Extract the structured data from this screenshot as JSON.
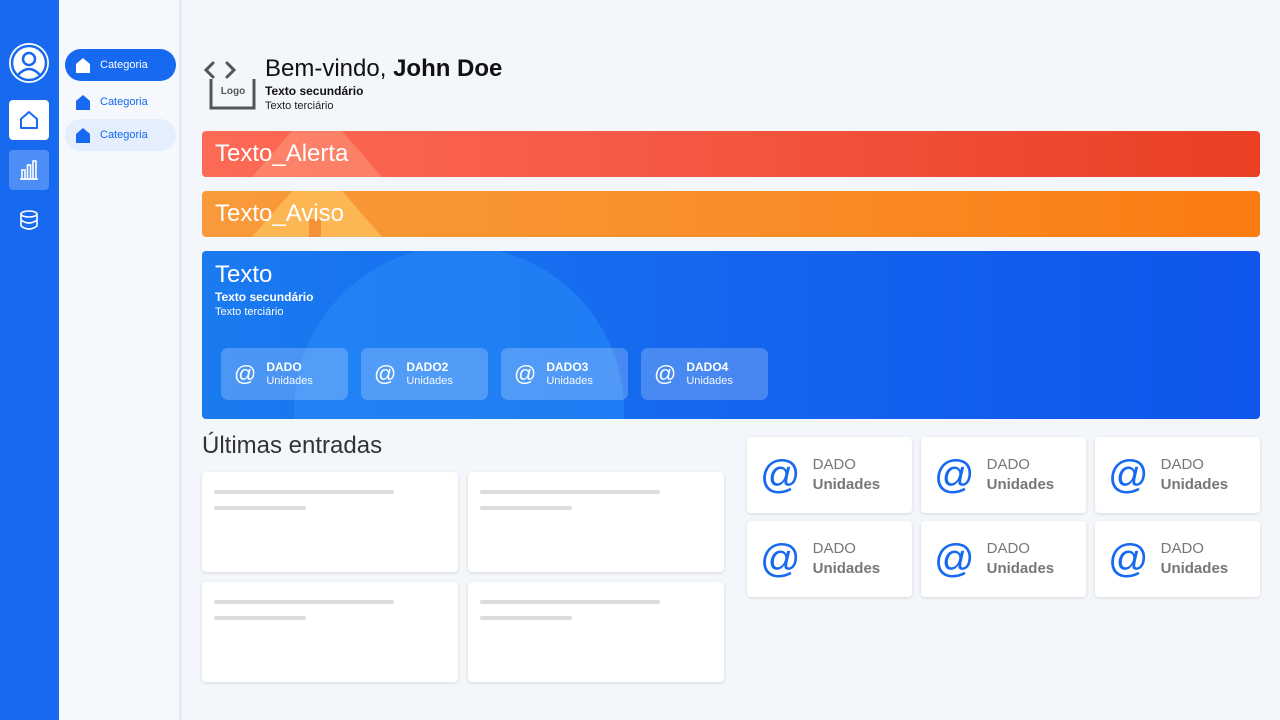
{
  "colors": {
    "primary": "#1769f0",
    "alert": "#ea3f23",
    "warning": "#fb7b10",
    "background": "#f3f6fa"
  },
  "rail": {
    "icons": [
      "user-avatar-icon",
      "home-icon",
      "bar-chart-icon",
      "database-icon"
    ]
  },
  "subnav": {
    "items": [
      {
        "label": "Categoria",
        "icon": "house-icon",
        "state": "active"
      },
      {
        "label": "Categoria",
        "icon": "house-icon",
        "state": "default"
      },
      {
        "label": "Categoria",
        "icon": "house-icon",
        "state": "hover"
      }
    ]
  },
  "header": {
    "logo_text": "Logo",
    "greeting_prefix": "Bem-vindo, ",
    "user_name": "John Doe",
    "secondary": "Texto secundário",
    "tertiary": "Texto terciário"
  },
  "banners": {
    "alert": "Texto_Alerta",
    "warning": "Texto_Aviso"
  },
  "hero": {
    "title": "Texto",
    "secondary": "Texto secundário",
    "tertiary": "Texto terciário",
    "chips": [
      {
        "value": "DADO",
        "unit": "Unidades"
      },
      {
        "value": "DADO2",
        "unit": "Unidades"
      },
      {
        "value": "DADO3",
        "unit": "Unidades"
      },
      {
        "value": "DADO4",
        "unit": "Unidades"
      }
    ]
  },
  "latest": {
    "title": "Últimas entradas"
  },
  "stats": [
    {
      "value": "DADO",
      "unit": "Unidades"
    },
    {
      "value": "DADO",
      "unit": "Unidades"
    },
    {
      "value": "DADO",
      "unit": "Unidades"
    },
    {
      "value": "DADO",
      "unit": "Unidades"
    },
    {
      "value": "DADO",
      "unit": "Unidades"
    },
    {
      "value": "DADO",
      "unit": "Unidades"
    }
  ]
}
